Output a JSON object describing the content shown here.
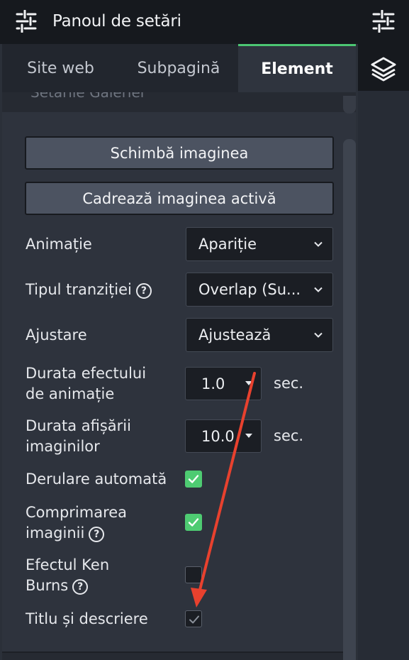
{
  "header": {
    "title": "Panoul de setări",
    "title_icon": "sliders-icon",
    "side_icons": [
      "sliders-icon",
      "layers-icon"
    ]
  },
  "tabs": [
    {
      "label": "Site web",
      "active": false
    },
    {
      "label": "Subpagină",
      "active": false
    },
    {
      "label": "Element",
      "active": true
    }
  ],
  "section": {
    "cut_heading": "Setările Galeriei"
  },
  "buttons": {
    "change_image": "Schimbă imaginea",
    "crop_image": "Cadrează imaginea activă"
  },
  "fields": {
    "animation": {
      "label": "Animație",
      "value": "Apariție"
    },
    "transition": {
      "label": "Tipul tranziției",
      "value": "Overlap (Su..."
    },
    "fit": {
      "label": "Ajustare",
      "value": "Ajustează"
    },
    "effect_duration": {
      "label_line1": "Durata efectului",
      "label_line2": "de animație",
      "value": "1.0",
      "unit": "sec."
    },
    "display_duration": {
      "label_line1": "Durata afișării",
      "label_line2": "imaginilor",
      "value": "10.0",
      "unit": "sec."
    },
    "autoplay": {
      "label": "Derulare automată",
      "checked": true
    },
    "compression": {
      "label_line1": "Comprimarea",
      "label_line2": "imaginii",
      "checked": true
    },
    "ken_burns": {
      "label_line1": "Efectul Ken",
      "label_line2": "Burns",
      "checked": false
    },
    "title_desc": {
      "label": "Titlu și descriere",
      "checked": true
    }
  },
  "help_glyph": "?",
  "colors": {
    "accent_green": "#4ecb72",
    "annotation_arrow": "#e8412e"
  }
}
